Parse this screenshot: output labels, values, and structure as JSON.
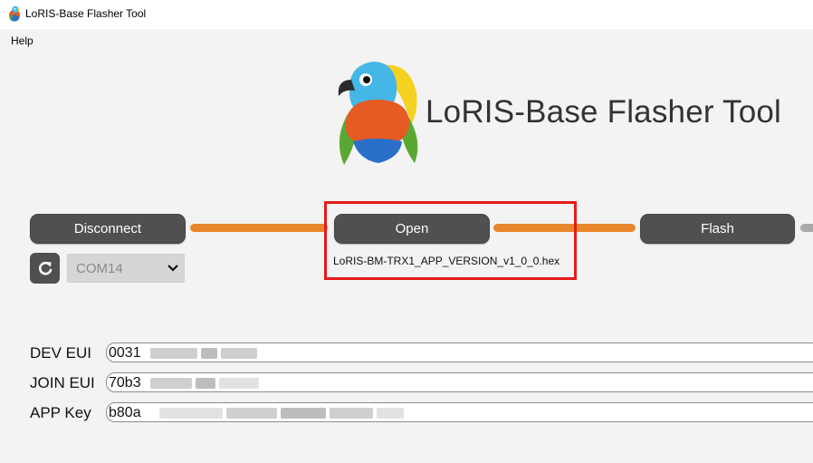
{
  "window": {
    "title": "LoRIS-Base Flasher Tool"
  },
  "menu": {
    "help_label": "Help"
  },
  "header": {
    "heading": "LoRIS-Base Flasher Tool"
  },
  "steps": {
    "disconnect_label": "Disconnect",
    "open_label": "Open",
    "flash_label": "Flash",
    "file_name": "LoRIS-BM-TRX1_APP_VERSION_v1_0_0.hex"
  },
  "port": {
    "selected": "COM14"
  },
  "fields": {
    "dev_eui": {
      "label": "DEV EUI",
      "value_prefix": "0031"
    },
    "join_eui": {
      "label": "JOIN EUI",
      "value_prefix": "70b3"
    },
    "app_key": {
      "label": "APP Key",
      "value_prefix": "b80a"
    }
  },
  "colors": {
    "connector_active": "#e8862b",
    "connector_inactive": "#a9a9a9",
    "button_bg": "#505050",
    "highlight": "#e51a1a"
  },
  "icons": {
    "refresh": "refresh-icon",
    "dropdown": "chevron-down-icon",
    "app": "parrot-icon"
  }
}
